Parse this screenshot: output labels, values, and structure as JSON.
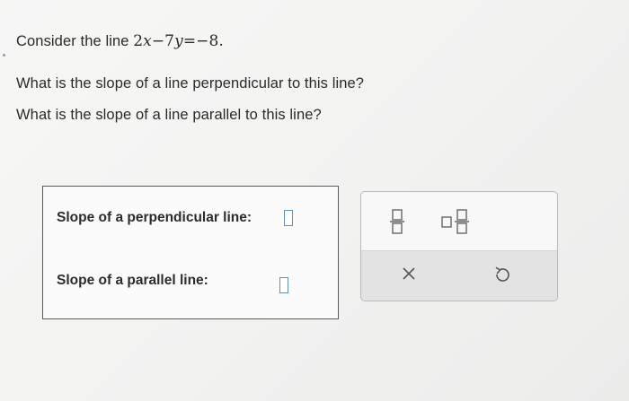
{
  "question": {
    "intro": "Consider the line ",
    "equation_tail": "=−8.",
    "line2": "What is the slope of a line perpendicular to this line?",
    "line3": "What is the slope of a line parallel to this line?"
  },
  "answers": {
    "perpendicular_label": "Slope of a perpendicular line:",
    "perpendicular_value": "",
    "parallel_label": "Slope of a parallel line:",
    "parallel_value": ""
  },
  "toolbar": {
    "fraction_icon": "fraction-icon",
    "mixed_number_icon": "mixed-number-icon",
    "clear_icon": "close-icon",
    "undo_icon": "undo-icon"
  },
  "colors": {
    "input_border": "#5a92c4",
    "panel_bottom": "#e3e3e3"
  }
}
